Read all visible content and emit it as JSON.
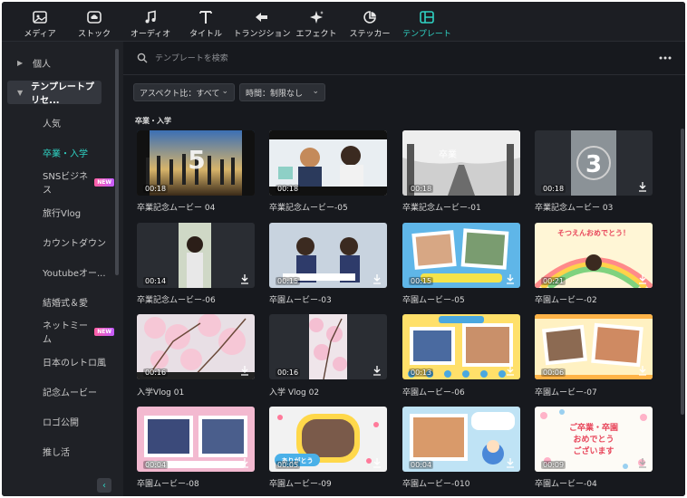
{
  "toolbar": {
    "items": [
      {
        "label": "メディア",
        "icon": "media-icon"
      },
      {
        "label": "ストック",
        "icon": "stock-cloud-icon"
      },
      {
        "label": "オーディオ",
        "icon": "music-note-icon"
      },
      {
        "label": "タイトル",
        "icon": "text-t-icon"
      },
      {
        "label": "トランジション",
        "icon": "transition-icon"
      },
      {
        "label": "エフェクト",
        "icon": "sparkle-icon"
      },
      {
        "label": "ステッカー",
        "icon": "sticker-icon"
      },
      {
        "label": "テンプレート",
        "icon": "template-icon"
      }
    ],
    "active_index": 7
  },
  "sidebar": {
    "personal": "個人",
    "preset": "テンプレートプリセ...",
    "items": [
      {
        "label": "人気"
      },
      {
        "label": "卒業・入学"
      },
      {
        "label": "SNSビジネス",
        "badge": "NEW"
      },
      {
        "label": "旅行Vlog"
      },
      {
        "label": "カウントダウン"
      },
      {
        "label": "Youtubeオー..."
      },
      {
        "label": "結婚式＆愛"
      },
      {
        "label": "ネットミーム",
        "badge": "NEW"
      },
      {
        "label": "日本のレトロ風"
      },
      {
        "label": "記念ムービー"
      },
      {
        "label": "ロゴ公開"
      },
      {
        "label": "推し活"
      }
    ],
    "active_item": "卒業・入学"
  },
  "search": {
    "placeholder": "テンプレートを検索"
  },
  "filters": {
    "aspect": "アスペクト比：すべて",
    "duration": "時間：制限なし"
  },
  "section": {
    "title": "卒業・入学"
  },
  "cards": [
    {
      "title": "卒業記念ムービー 04",
      "duration": "00:18",
      "download": false
    },
    {
      "title": "卒業記念ムービー-05",
      "duration": "00:18",
      "download": false
    },
    {
      "title": "卒業記念ムービー-01",
      "duration": "00:18",
      "download": false
    },
    {
      "title": "卒業記念ムービー 03",
      "duration": "00:18",
      "download": true
    },
    {
      "title": "卒業記念ムービー-06",
      "duration": "00:14",
      "download": true
    },
    {
      "title": "卒園ムービー-03",
      "duration": "00:15",
      "download": true
    },
    {
      "title": "卒園ムービー-05",
      "duration": "00:15",
      "download": true
    },
    {
      "title": "卒園ムービー-02",
      "duration": "00:21",
      "download": true
    },
    {
      "title": "入学Vlog 01",
      "duration": "00:16",
      "download": true
    },
    {
      "title": "入学 Vlog 02",
      "duration": "00:16",
      "download": true
    },
    {
      "title": "卒園ムービー-06",
      "duration": "00:13",
      "download": true
    },
    {
      "title": "卒園ムービー-07",
      "duration": "00:06",
      "download": true
    },
    {
      "title": "卒園ムービー-08",
      "duration": "00:04",
      "download": true
    },
    {
      "title": "卒園ムービー-09",
      "duration": "00:05",
      "download": true
    },
    {
      "title": "卒園ムービー-010",
      "duration": "00:04",
      "download": true
    },
    {
      "title": "卒園ムービー-04",
      "duration": "00:09",
      "download": true
    }
  ],
  "thumb_text": {
    "countdown_5": "5",
    "countdown_3": "3",
    "kanji_graduation": "卒業",
    "sotsuen_omedetou": "そつえんおめでとう！",
    "arigatou": "ありがとう",
    "sotsugyo_nyugaku_kanji": "ご卒業・卒園\nおめでとう\nございます"
  },
  "colors": {
    "accent": "#2fd2c3",
    "background": "#17191e",
    "sidebar": "#1f2126",
    "badge": "#ff5fa2"
  }
}
